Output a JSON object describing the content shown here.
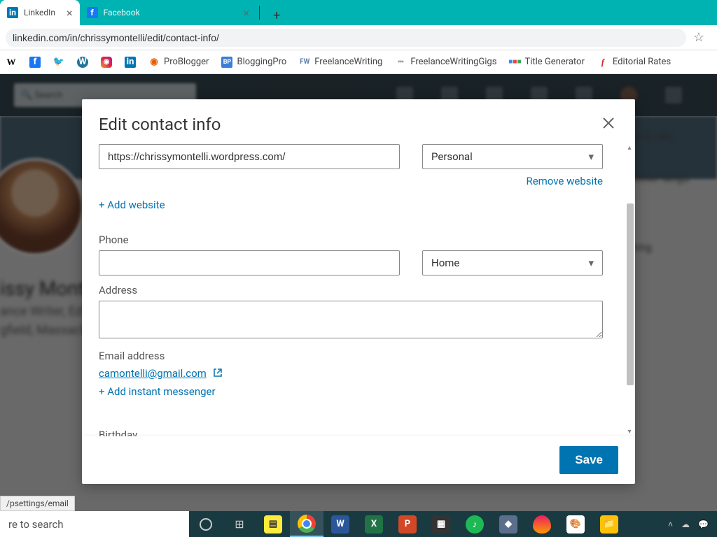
{
  "tabs": [
    {
      "title": "LinkedIn",
      "active": true
    },
    {
      "title": "Facebook",
      "active": false
    }
  ],
  "url": "linkedin.com/in/chrissymontelli/edit/contact-info/",
  "bookmarks": [
    {
      "label": "",
      "icon": "W",
      "color": "#000"
    },
    {
      "label": "",
      "icon": "f",
      "color": "#1877f2"
    },
    {
      "label": "",
      "icon": "t",
      "color": "#1da1f2"
    },
    {
      "label": "",
      "icon": "W",
      "color": "#21759b"
    },
    {
      "label": "",
      "icon": "ig",
      "color": "#e1306c"
    },
    {
      "label": "",
      "icon": "in",
      "color": "#0077b5"
    },
    {
      "label": "ProBlogger",
      "icon": "PB",
      "color": "#e85d00"
    },
    {
      "label": "BloggingPro",
      "icon": "BP",
      "color": "#3b7dd8"
    },
    {
      "label": "FreelanceWriting",
      "icon": "FW",
      "color": "#5b7fa6"
    },
    {
      "label": "FreelanceWritingGigs",
      "icon": "fg",
      "color": "#7a7a7a"
    },
    {
      "label": "Title Generator",
      "icon": "TG",
      "color": "#d64040"
    },
    {
      "label": "Editorial Rates",
      "icon": "f",
      "color": "#d62828"
    }
  ],
  "background": {
    "search_placeholder": "Search",
    "profile_name": "issy Montell",
    "profile_sub1": "ance Writer, Ed",
    "profile_sub2": "gfield, Massachus",
    "right1": "le & URL",
    "right2": "other langu",
    "right3": "ting",
    "right4": "Edit O"
  },
  "modal": {
    "title": "Edit contact info",
    "website_url": "https://chrissymontelli.wordpress.com/",
    "website_type": "Personal",
    "remove_website": "Remove website",
    "add_website": "+ Add website",
    "phone_label": "Phone",
    "phone_value": "",
    "phone_type": "Home",
    "address_label": "Address",
    "address_value": "",
    "email_label": "Email address",
    "email_value": "camontelli@gmail.com",
    "add_im": "+ Add instant messenger",
    "birthday_label": "Birthday",
    "save": "Save"
  },
  "status_tooltip": "/psettings/email",
  "taskbar": {
    "search_placeholder": "re to search"
  }
}
